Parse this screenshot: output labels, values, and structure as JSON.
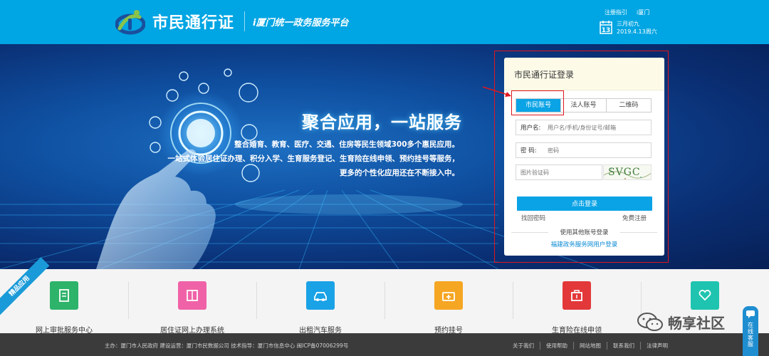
{
  "header": {
    "logo_title": "市民通行证",
    "subtitle": "i厦门统一政务服务平台",
    "guide_link": "注册指引",
    "home_link": "i厦门",
    "lunar_date": "三月初九",
    "solar_date": "2019.4.13周六",
    "calendar_day": "13"
  },
  "hero": {
    "title": "聚合应用，一站服务",
    "line1": "整合婚育、教育、医疗、交通、住房等民生领域300多个惠民应用。",
    "line2": "一站式体验居住证办理、积分入学、生育服务登记、生育险在线申领、预约挂号等服务，",
    "line3": "更多的个性化应用还在不断接入中。"
  },
  "login": {
    "title": "市民通行证登录",
    "tabs": [
      "市民账号",
      "法人账号",
      "二维码"
    ],
    "username_label": "用户名:",
    "username_placeholder": "用户名/手机/身份证号/邮箱",
    "password_label": "密  码:",
    "password_placeholder": "密码",
    "captcha_placeholder": "图片验证码",
    "captcha_text": "SVGC",
    "submit_label": "点击登录",
    "forgot_label": "找回密码",
    "register_label": "免费注册",
    "other_label": "使用其他账号登录",
    "alt_login_label": "福建政务服务网用户登录"
  },
  "services": {
    "ribbon": "精品应用",
    "items": [
      {
        "label": "网上审批服务中心",
        "color": "#2db36a"
      },
      {
        "label": "居住证网上办理系统",
        "color": "#f062a8"
      },
      {
        "label": "出租汽车服务",
        "color": "#1aa2e6"
      },
      {
        "label": "预约挂号",
        "color": "#f5a623"
      },
      {
        "label": "生育险在线申领",
        "color": "#e3383a"
      },
      {
        "label": "",
        "color": "#1fc4b0"
      }
    ]
  },
  "watermark": {
    "text": "畅享社区"
  },
  "online_service": {
    "label": "在线客服"
  },
  "footer": {
    "info": "主办：厦门市人民政府  建设运营：厦门市民数据公司  技术指导：厦门市信息中心  闽ICP备07006299号",
    "links": [
      "关于我们",
      "使用帮助",
      "网站地图",
      "联系我们",
      "法律声明"
    ]
  },
  "colors": {
    "header_bg": "#00a5e3",
    "accent": "#0aa3e6",
    "annotation": "#e0161d",
    "footer_bg": "#3b3b3b"
  }
}
